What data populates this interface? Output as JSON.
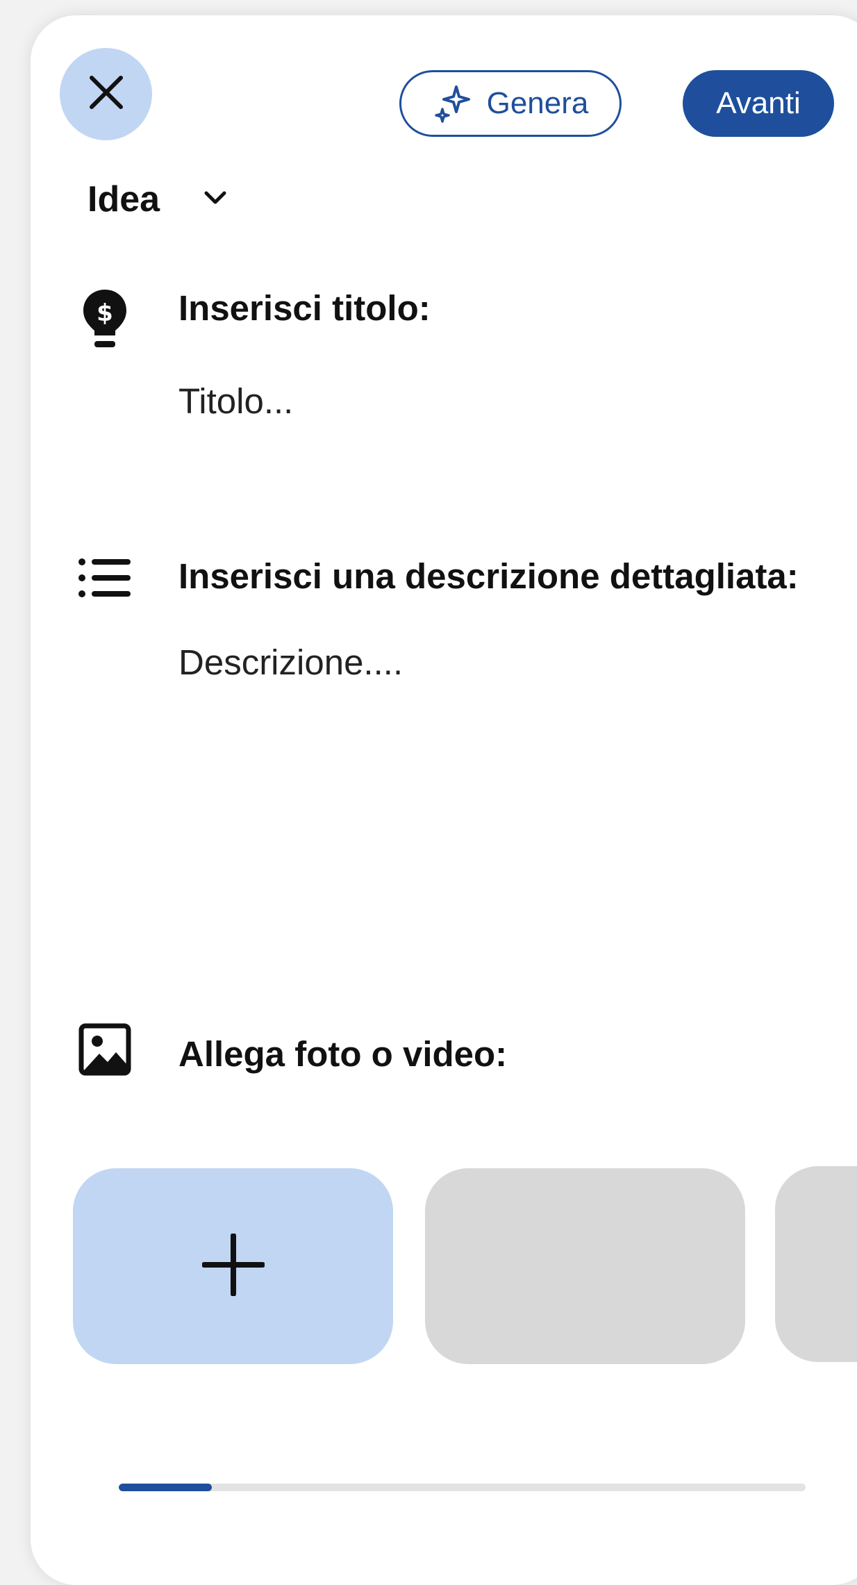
{
  "header": {
    "close_icon": "close-icon",
    "generate_label": "Genera",
    "generate_icon": "sparkle-icon",
    "next_label": "Avanti"
  },
  "type_selector": {
    "value": "Idea",
    "icon": "chevron-down-icon"
  },
  "title_section": {
    "icon": "lightbulb-dollar-icon",
    "label": "Inserisci titolo:",
    "placeholder": "Titolo..."
  },
  "description_section": {
    "icon": "list-icon",
    "label": "Inserisci una descrizione dettagliata:",
    "placeholder": "Descrizione...."
  },
  "media_section": {
    "icon": "image-icon",
    "label": "Allega foto o video:",
    "add_icon": "plus-icon"
  },
  "progress": {
    "value": 0.135
  },
  "colors": {
    "accent": "#1f4f9c",
    "accent_light": "#c1d6f3",
    "placeholder_tile": "#d8d8d8",
    "track": "#e3e3e3"
  }
}
